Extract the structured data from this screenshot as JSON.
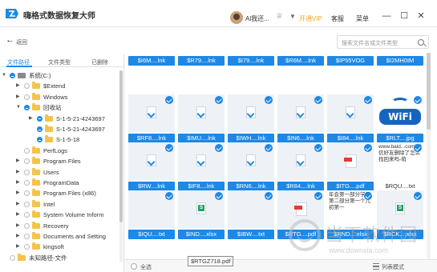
{
  "app": {
    "title": "嗨格式数据恢复大师",
    "user_name": "Al我还...",
    "vip_label": "开通VIP",
    "service_label": "客服",
    "menu_label": "菜单",
    "accent_color": "#1e88e5",
    "vip_color": "#f5a623"
  },
  "toolbar": {
    "back_label": "返回",
    "search_placeholder": "搜索文件名或文件类型"
  },
  "left_tabs": [
    "文件路径",
    "文件类型",
    "已删除"
  ],
  "tree": [
    {
      "label": "系统(C:)",
      "depth": 0,
      "arrow": "down",
      "icon": "drive-icon",
      "checked": true
    },
    {
      "label": "$Extend",
      "depth": 1,
      "arrow": "right",
      "icon": "folder-icon",
      "checked": false
    },
    {
      "label": "Windows",
      "depth": 1,
      "arrow": "right",
      "icon": "folder-icon",
      "checked": false
    },
    {
      "label": "回收站",
      "depth": 1,
      "arrow": "down",
      "icon": "folder-icon",
      "checked": true
    },
    {
      "label": "S-1-5-21-4243697",
      "depth": 2,
      "arrow": "right",
      "icon": "folder-icon",
      "checked": true
    },
    {
      "label": "S-1-5-21-4243697",
      "depth": 2,
      "arrow": "none",
      "icon": "folder-icon",
      "checked": true
    },
    {
      "label": "S-1-5-18",
      "depth": 2,
      "arrow": "none",
      "icon": "folder-icon",
      "checked": true
    },
    {
      "label": "PerfLogs",
      "depth": 1,
      "arrow": "none",
      "icon": "folder-icon",
      "checked": false
    },
    {
      "label": "Program Files",
      "depth": 1,
      "arrow": "right",
      "icon": "folder-icon",
      "checked": false
    },
    {
      "label": "Users",
      "depth": 1,
      "arrow": "right",
      "icon": "folder-icon",
      "checked": false
    },
    {
      "label": "ProgramData",
      "depth": 1,
      "arrow": "right",
      "icon": "folder-icon",
      "checked": false
    },
    {
      "label": "Program Files (x86)",
      "depth": 1,
      "arrow": "right",
      "icon": "folder-icon",
      "checked": false
    },
    {
      "label": "Intel",
      "depth": 1,
      "arrow": "right",
      "icon": "folder-icon",
      "checked": false
    },
    {
      "label": "System Volume Inform",
      "depth": 1,
      "arrow": "right",
      "icon": "folder-icon",
      "checked": false
    },
    {
      "label": "Recovery",
      "depth": 1,
      "arrow": "right",
      "icon": "folder-icon",
      "checked": false
    },
    {
      "label": "Documents and Setting",
      "depth": 1,
      "arrow": "right",
      "icon": "folder-icon",
      "checked": false
    },
    {
      "label": "kingsoft",
      "depth": 1,
      "arrow": "right",
      "icon": "folder-icon",
      "checked": false
    },
    {
      "label": "未知路径-文件",
      "depth": 0,
      "arrow": "none",
      "icon": "folder-icon",
      "checked": false
    }
  ],
  "files": [
    [
      {
        "name": "$I6M....lnk",
        "icon": "none"
      },
      {
        "name": "$R79....lnk",
        "icon": "none"
      },
      {
        "name": "$I79....lnk",
        "icon": "none"
      },
      {
        "name": "$R6M....lnk",
        "icon": "none"
      },
      {
        "name": "$IP55VOG",
        "icon": "none"
      },
      {
        "name": "$I2MH0IM",
        "icon": "none"
      }
    ],
    [
      {
        "name": "$RF8....lnk",
        "icon": "shortcut-doc-icon"
      },
      {
        "name": "$IMU....lnk",
        "icon": "shortcut-doc-icon"
      },
      {
        "name": "$IWH....lnk",
        "icon": "shortcut-doc-icon"
      },
      {
        "name": "$IN6....lnk",
        "icon": "shortcut-doc-icon"
      },
      {
        "name": "$I84....lnk",
        "icon": "shortcut-doc-icon"
      },
      {
        "name": "$RLT....jpg",
        "icon": "wifi-image"
      }
    ],
    [
      {
        "name": "$RW....lnk",
        "icon": "shortcut-doc-icon"
      },
      {
        "name": "$IF8....lnk",
        "icon": "shortcut-doc-icon"
      },
      {
        "name": "$RN6....lnk",
        "icon": "shortcut-doc-icon"
      },
      {
        "name": "$R84....lnk",
        "icon": "shortcut-doc-icon"
      },
      {
        "name": "$ITG....pdf",
        "icon": "pdf-icon"
      },
      {
        "name": "$RQU....txt",
        "icon": "text-preview",
        "preview": "www.baid...com]微信好友删除了怎么找回来吗-萌"
      }
    ],
    [
      {
        "name": "$IQU....txt",
        "icon": "none"
      },
      {
        "name": "$IND....xlsx",
        "icon": "xlsx-icon"
      },
      {
        "name": "$IBW....txt",
        "icon": "none"
      },
      {
        "name": "$RTG....pdf",
        "icon": "pdf-icon"
      },
      {
        "name": "$RND....xlsx",
        "icon": "text-preview",
        "preview": "年会第一部分学习第二部分第一个儿初第一"
      },
      {
        "name": "$RCK....xlsx",
        "icon": "xlsx-icon"
      }
    ]
  ],
  "bottom": {
    "select_all_label": "全选",
    "list_mode_label": "列表模式",
    "tooltip": "$RTGZ718.pdf"
  },
  "watermark": {
    "text": "当下软件园",
    "sub": "www.downxia.com"
  }
}
